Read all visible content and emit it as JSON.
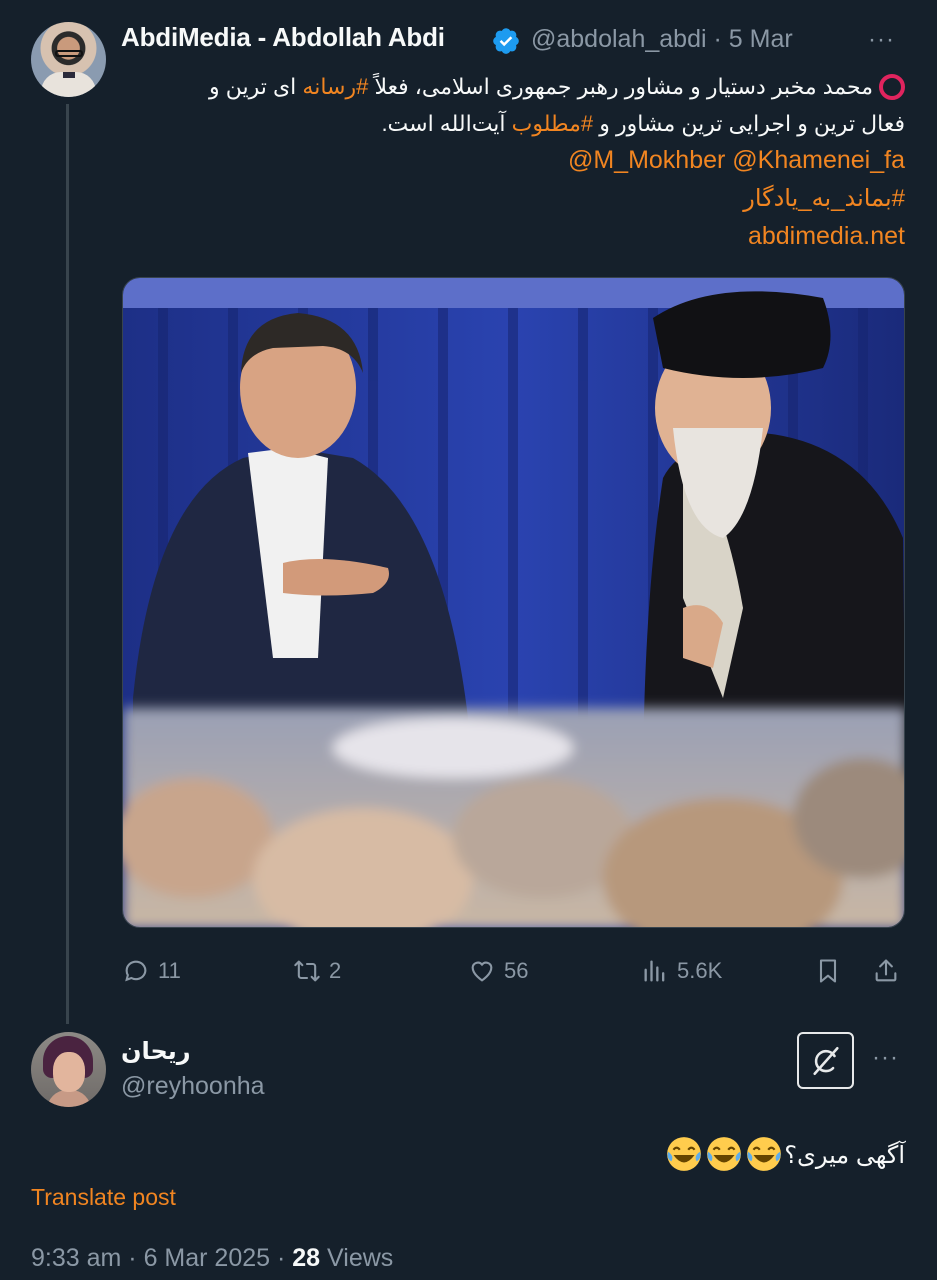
{
  "post": {
    "author_name": "AbdiMedia - Abdollah Abdi",
    "author_handle": "@abdolah_abdi",
    "date": "5 Mar",
    "separator": "·",
    "more": "···",
    "text_line1_part1": "محمد مخبر دستیار و مشاور رهبر جمهوری اسلامی، فعلاً ",
    "text_hashtag1": "#رسانه",
    "text_line1_part2": " ای ترین و",
    "text_line2_part1": "فعال ترین و اجرایی ترین مشاور و ",
    "text_hashtag_matloob": "#مطلوب",
    "text_line2_part2": " آیت‌الله است.",
    "mentions": "@M_Mokhber @Khamenei_fa",
    "hashtag2": "#بماند_به_یادگار",
    "link": "abdimedia.net",
    "photo_alt": "photo",
    "stats": {
      "replies": "11",
      "reposts": "2",
      "likes": "56",
      "views": "5.6K"
    }
  },
  "reply": {
    "author_name": "ریحان",
    "author_handle": "@reyhoonha",
    "more": "···",
    "text": "آگهی میری؟",
    "emoji_count": 3,
    "translate_label": "Translate post",
    "time": "9:33 am",
    "date": "6 Mar 2025",
    "views_count": "28",
    "views_label": "Views",
    "dot": "·"
  },
  "colors": {
    "background": "#15202b",
    "accent": "#f18521",
    "secondary_text": "#8b98a5",
    "verified": "#1d9bf0"
  }
}
